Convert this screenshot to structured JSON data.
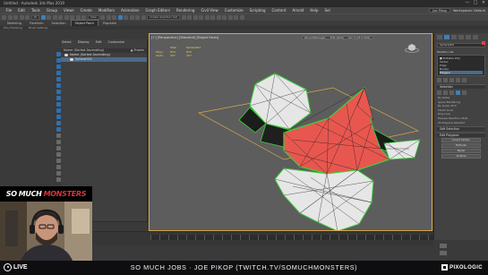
{
  "window": {
    "title": "Untitled - Autodesk 3ds Max 2019",
    "controls": [
      "—",
      "□",
      "✕"
    ]
  },
  "menubar": {
    "items": [
      "File",
      "Edit",
      "Tools",
      "Group",
      "Views",
      "Create",
      "Modifiers",
      "Animation",
      "Graph Editors",
      "Rendering",
      "Civil View",
      "Customize",
      "Scripting",
      "Content",
      "Arnold",
      "Help",
      "Sol"
    ],
    "user": "Joe Pikop",
    "workspace_label": "Workspaces: Default"
  },
  "toolbar": {
    "dropdown_all": "All",
    "dropdown_view": "View",
    "dropdown_selset": "Create Selection Set"
  },
  "ribbon": {
    "tabs": [
      "Modeling",
      "Freeform",
      "Selection",
      "Object Paint",
      "Populate"
    ],
    "active_tab": "Object Paint",
    "sub_items": [
      "Poly Modeling",
      "Brush Settings"
    ]
  },
  "explorer": {
    "menu": [
      "Select",
      "Display",
      "Edit",
      "Customize"
    ],
    "header_name": "Name (Sorted Ascending)",
    "header_frozen": "▲ Frozen",
    "rows": [
      {
        "name": "Name (Sorted Ascending)"
      },
      {
        "name": "Sphere001"
      }
    ],
    "footer_label": "Selection Set:"
  },
  "viewport": {
    "label": "[+] [Perspective] [Standard] [Edged Faces]",
    "topbar": [
      "ZbrushManager",
      "Edit (PGS)",
      "Sel: 0 (Pt 0 PGS)"
    ],
    "stats": {
      "header": [
        "",
        "Total",
        "Sphere001"
      ],
      "polys_label": "Polys:",
      "polys_total": "870",
      "polys_obj": "870",
      "verts_label": "Verts:",
      "verts_total": "437",
      "verts_obj": "437"
    },
    "colors": {
      "background": "#5d5d5d",
      "selected_faces": "#e8574f",
      "unselected_faces": "#e6e6e6",
      "edges": "#1a1a1a",
      "selection_outline": "#3bd13b",
      "grid_plane": "#d6a94a"
    }
  },
  "command_panel": {
    "object_name": "Sphere001",
    "modifier_list_label": "Modifier List",
    "stack": [
      "■ Editable Poly",
      "  Vertex",
      "  Edge",
      "  Border",
      "  Polygon",
      "  Element"
    ],
    "stack_selected_index": 4,
    "sections": {
      "selection": "Selection",
      "soft_selection": "Soft Selection",
      "edit_polygons": "Edit Polygons",
      "polymodel": "Polymodel Sets"
    },
    "selection_texts": [
      "By Vertex",
      "Ignore Backfacing",
      "By Angle: 45.0",
      "Shrink   Grow",
      "Ring   Loop"
    ],
    "preview_label": "Preview Selection",
    "preview_value": "Multi",
    "selected_text": "24 Polygons Selected",
    "buttons": [
      "Insert Vertex",
      "Extrude",
      "Bevel",
      "Outline"
    ],
    "accent": "#3d7fb8"
  },
  "overlay": {
    "logo_word1": "SO",
    "logo_word2": "MUCH",
    "logo_word3": "MONSTERS",
    "live_label": "LIVE",
    "banner_text": "SO MUCH JOBS · JOE PIKOP (TWITCH.TV/SOMUCHMONSTERS)",
    "brand": "PIXOLOGIC"
  }
}
